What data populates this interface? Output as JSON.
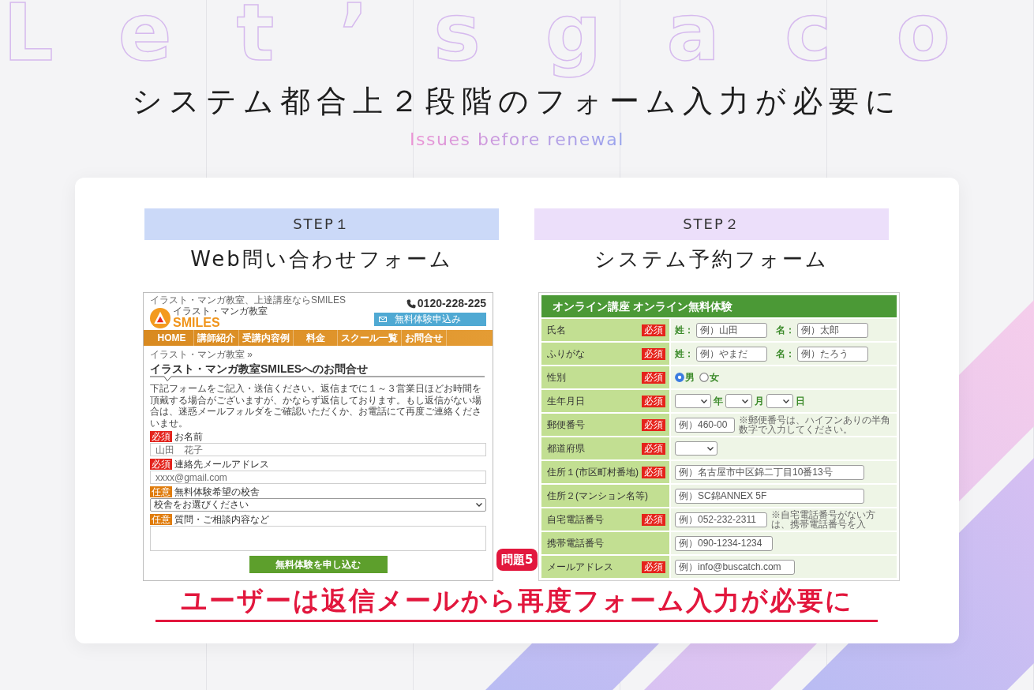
{
  "background_text": "Let’sgaco",
  "header": {
    "title": "システム都合上２段階のフォーム入力が必要に",
    "subtitle": "Issues before renewal"
  },
  "steps": [
    {
      "label": "STEP１",
      "color": "#cbd9f8",
      "title": "Web問い合わせフォーム",
      "screenshot": {
        "kind": "web_form",
        "tagline": "イラスト・マンガ教室、上達講座ならSMILES",
        "logo_caption": "イラスト・マンガ教室",
        "logo_text": "SMILES",
        "phone": "0120-228-225",
        "cta_button": "無料体験申込み",
        "nav": [
          "HOME",
          "講師紹介",
          "受講内容例",
          "料金",
          "スクール一覧",
          "お問合せ"
        ],
        "breadcrumb": "イラスト・マンガ教室 »",
        "heading": "イラスト・マンガ教室SMILESへのお問合せ",
        "intro": "下記フォームをご記入・送信ください。返信までに１～３営業日ほどお時間を頂戴する場合がございますが、かならず返信しております。もし返信がない場合は、迷惑メールフォルダをご確認いただくか、お電話にて再度ご連絡くださいませ。",
        "fields": [
          {
            "kind": "input",
            "badge": "必須",
            "required": true,
            "label": "お名前",
            "placeholder": "山田　花子"
          },
          {
            "kind": "input",
            "badge": "必須",
            "required": true,
            "label": "連絡先メールアドレス",
            "placeholder": "xxxx@gmail.com"
          },
          {
            "kind": "select",
            "badge": "任意",
            "required": false,
            "label": "無料体験希望の校舎",
            "value": "校舎をお選びください"
          },
          {
            "kind": "textarea",
            "badge": "任意",
            "required": false,
            "label": "質問・ご相談内容など"
          }
        ],
        "submit": "無料体験を申し込む"
      }
    },
    {
      "label": "STEP２",
      "color": "#ecdffa",
      "title": "システム予約フォーム",
      "screenshot": {
        "kind": "booking_form",
        "heading": "オンライン講座 オンライン無料体験",
        "rows": [
          {
            "label": "氏名",
            "badge": "必須",
            "kind": "name_pair",
            "parts": [
              {
                "prefix": "姓：",
                "placeholder": "例）山田"
              },
              {
                "prefix": "名：",
                "placeholder": "例）太郎"
              }
            ]
          },
          {
            "label": "ふりがな",
            "badge": "必須",
            "kind": "name_pair",
            "parts": [
              {
                "prefix": "姓：",
                "placeholder": "例）やまだ"
              },
              {
                "prefix": "名：",
                "placeholder": "例）たろう"
              }
            ]
          },
          {
            "label": "性別",
            "badge": "必須",
            "kind": "radio",
            "options": [
              {
                "label": "男",
                "selected": true
              },
              {
                "label": "女",
                "selected": false
              }
            ]
          },
          {
            "label": "生年月日",
            "badge": "必須",
            "kind": "date",
            "units": [
              "年",
              "月",
              "日"
            ]
          },
          {
            "label": "郵便番号",
            "badge": "必須",
            "kind": "short_input",
            "placeholder": "例）460-00",
            "note": "※郵便番号は、ハイフンありの半角数字で入力してください。"
          },
          {
            "label": "都道府県",
            "badge": "必須",
            "kind": "select"
          },
          {
            "label": "住所１(市区町村番地)",
            "badge": "必須",
            "kind": "wide_input",
            "placeholder": "例）名古屋市中区錦二丁目10番13号"
          },
          {
            "label": "住所２(マンション名等)",
            "kind": "wide_input",
            "placeholder": "例）SC錦ANNEX 5F"
          },
          {
            "label": "自宅電話番号",
            "badge": "必須",
            "kind": "short_input",
            "placeholder": "例）052-232-2311",
            "note": "※自宅電話番号がない方は、携帯電話番号を入"
          },
          {
            "label": "携帯電話番号",
            "kind": "short_input",
            "placeholder": "例）090-1234-1234"
          },
          {
            "label": "メールアドレス",
            "badge": "必須",
            "kind": "short_input",
            "placeholder": "例）info@buscatch.com"
          }
        ]
      }
    }
  ],
  "problem": {
    "badge": "問題5",
    "text": "ユーザーは返信メールから再度フォーム入力が必要に"
  }
}
